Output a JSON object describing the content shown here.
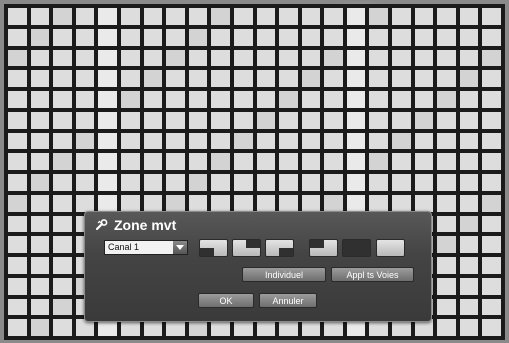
{
  "dialog": {
    "title": "Zone mvt",
    "title_icon": "wrench-icon",
    "channel_select": {
      "value": "Canal 1"
    },
    "layout_buttons": [
      "layout-bottom-left-icon",
      "layout-top-right-icon",
      "layout-bottom-right-icon",
      "layout-top-left-icon",
      "layout-full-icon",
      "layout-empty-icon"
    ],
    "individual_label": "Individuel",
    "apply_all_label": "Appl ts Voies",
    "ok_label": "OK",
    "cancel_label": "Annuler"
  }
}
